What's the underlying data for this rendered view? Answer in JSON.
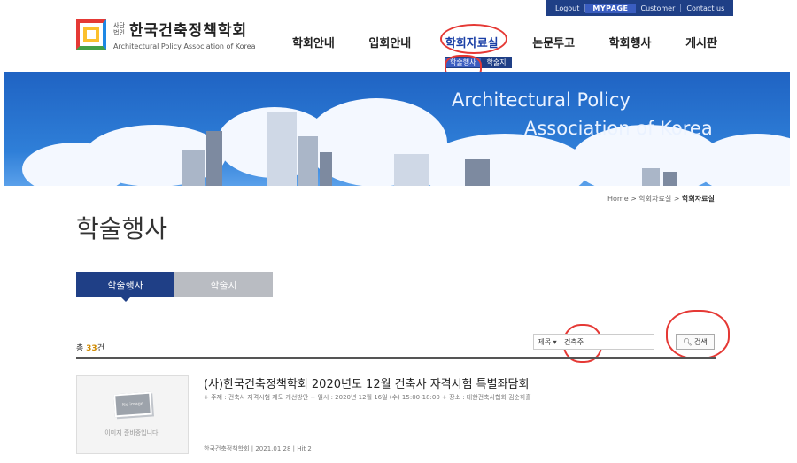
{
  "util": {
    "logout": "Logout",
    "mypage": "MYPAGE",
    "customer": "Customer",
    "contact": "Contact us"
  },
  "logo": {
    "small_line1": "사단",
    "small_line2": "법인",
    "name_ko": "한국건축정책학회",
    "name_en": "Architectural Policy Association of Korea"
  },
  "gnb": [
    "학회안내",
    "입회안내",
    "학회자료실",
    "논문투고",
    "학회행사",
    "게시판"
  ],
  "submenu": [
    "학술행사",
    "학술지"
  ],
  "banner": {
    "line1": "Architectural Policy",
    "line2": "Association of Korea"
  },
  "breadcrumb": {
    "home": "Home",
    "level1": "학회자료실",
    "current": "학회자료실"
  },
  "page_title": "학술행사",
  "tabs": [
    "학술행사",
    "학술지"
  ],
  "list": {
    "count_prefix": "총",
    "count": "33",
    "count_suffix": "건",
    "search_field": "제목",
    "search_value": "건축주",
    "search_button": "검색"
  },
  "post": {
    "noimage": "No image",
    "thumb_caption": "이미지 준비중입니다.",
    "title": "(사)한국건축정책학회 2020년도 12월 건축사 자격시험 특별좌담회",
    "desc": "+ 주제 : 건축사 자격시험 제도 개선방안 + 일시 : 2020년 12월 16일 (수) 15:00-18:00 + 장소 : 대한건축사협회 김순하홀",
    "meta": "한국건축정책학회 | 2021.01.28 | Hit 2"
  },
  "colors": {
    "navy": "#1f3f86",
    "accent": "#3a5dc0",
    "annotation": "#e53935"
  }
}
